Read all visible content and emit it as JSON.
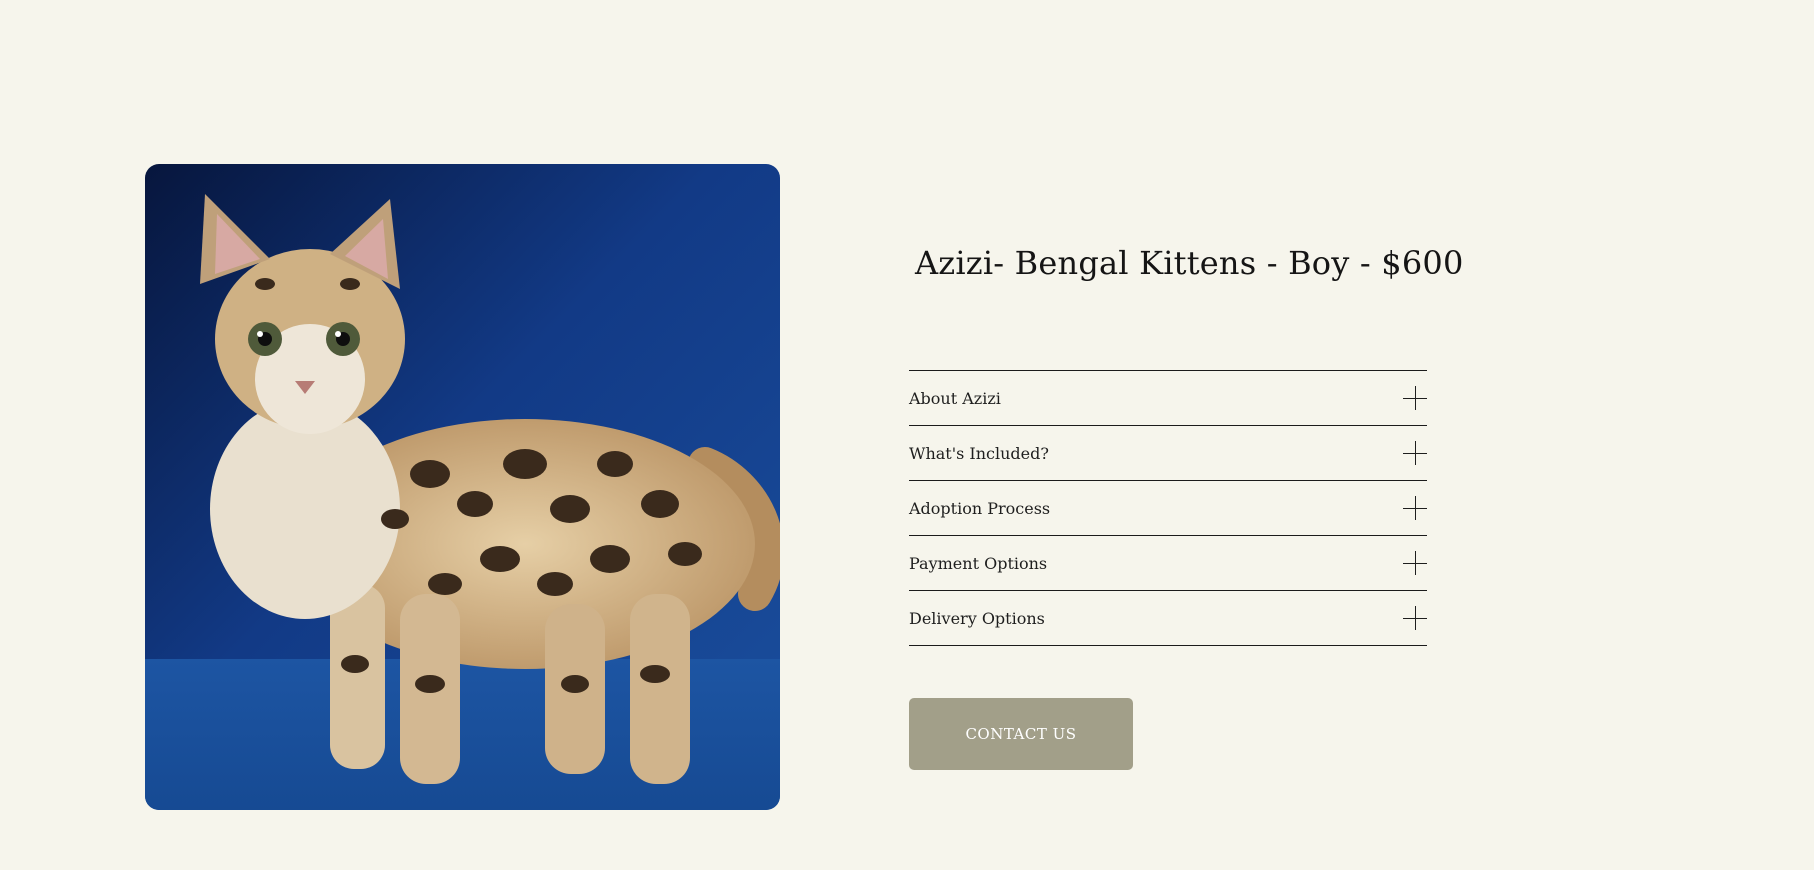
{
  "product": {
    "title": "Azizi- Bengal Kittens - Boy - $600",
    "image_alt": "Bengal kitten on blue backdrop"
  },
  "accordion": {
    "items": [
      {
        "label": "About Azizi",
        "icon": "plus-icon"
      },
      {
        "label": "What's Included?",
        "icon": "plus-icon"
      },
      {
        "label": "Adoption Process",
        "icon": "plus-icon"
      },
      {
        "label": "Payment Options",
        "icon": "plus-icon"
      },
      {
        "label": "Delivery Options",
        "icon": "plus-icon"
      }
    ]
  },
  "cta": {
    "contact_label": "CONTACT US"
  },
  "colors": {
    "background": "#f6f5ec",
    "button": "#a29f89",
    "photo_backdrop": "#0f2f6e"
  }
}
